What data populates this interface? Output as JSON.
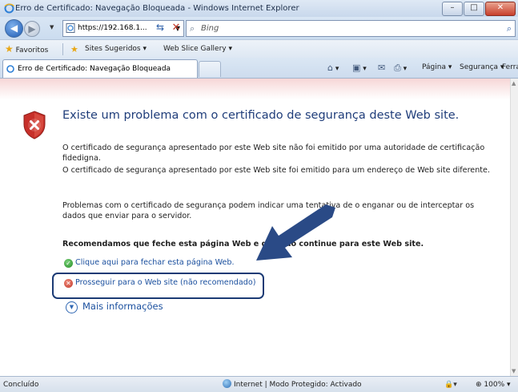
{
  "window": {
    "title": "Erro de Certificado: Navegação Bloqueada - Windows Internet Explorer",
    "minimize": "–",
    "maximize": "□",
    "close": "✕"
  },
  "address_bar": {
    "url": "https://192.168.1...",
    "search_placeholder": "Bing"
  },
  "favorites_bar": {
    "favorites_label": "Favoritos",
    "suggested_sites": "Sites Sugeridos ▾",
    "web_slice_gallery": "Web Slice Gallery ▾"
  },
  "tab": {
    "label": "Erro de Certificado: Navegação Bloqueada"
  },
  "command_bar": {
    "page_menu": "Página ▾",
    "safety_menu": "Segurança ▾",
    "tools_menu": "Ferramentas ▾"
  },
  "content": {
    "heading": "Existe um problema com o certificado de segurança deste Web site.",
    "paragraph1": "O certificado de segurança apresentado por este Web site não foi emitido por uma autoridade de certificação fidedigna.",
    "paragraph2": "O certificado de segurança apresentado por este Web site foi emitido para um endereço de Web site diferente.",
    "paragraph3": "Problemas com o certificado de segurança podem indicar uma tentativa de o enganar ou de interceptar os dados que enviar para o servidor.",
    "recommendation": "Recomendamos que feche esta página Web e que não continue para este Web site.",
    "close_link": "Clique aqui para fechar esta página Web.",
    "continue_link": "Prosseguir para o Web site (não recomendado)",
    "more_info": "Mais informações"
  },
  "status_bar": {
    "status": "Concluído",
    "zone": "Internet | Modo Protegido: Activado",
    "zoom": "100%"
  },
  "colors": {
    "link": "#1a4f9e",
    "heading": "#1f3d7a",
    "highlight_border": "#1c3b75",
    "arrow": "#2a4a86"
  }
}
